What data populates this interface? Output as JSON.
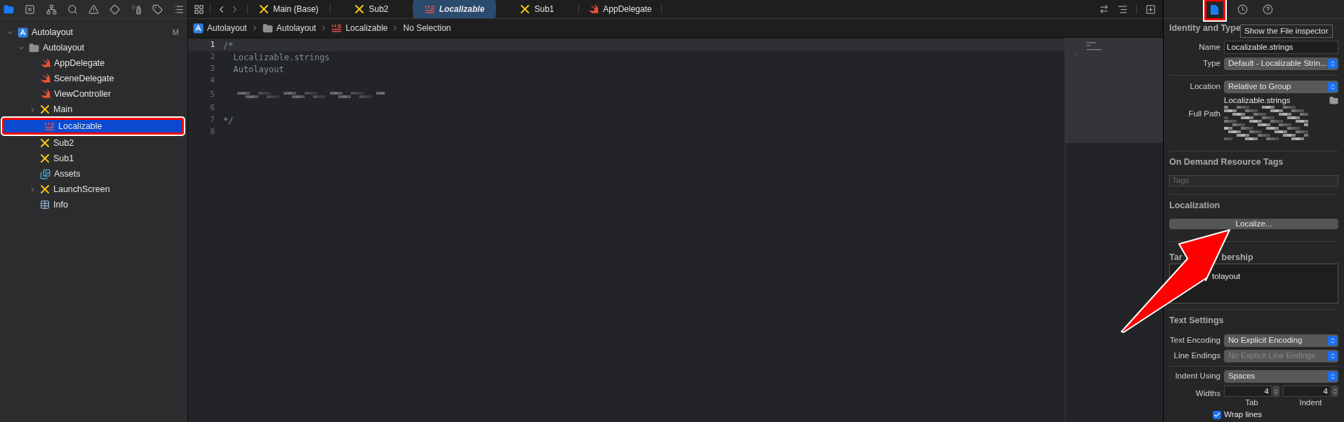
{
  "navigator": {
    "toolbar": [
      {
        "kind": "folder",
        "selected": true
      },
      {
        "kind": "xbox",
        "selected": false
      },
      {
        "kind": "hierarchy",
        "selected": false
      },
      {
        "kind": "search",
        "selected": false
      },
      {
        "kind": "warning",
        "selected": false
      },
      {
        "kind": "diamond",
        "selected": false
      },
      {
        "kind": "spray",
        "selected": false
      },
      {
        "kind": "tag",
        "selected": false
      },
      {
        "kind": "list",
        "selected": false
      }
    ],
    "tree": [
      {
        "name": "Autolayout",
        "kind": "project",
        "badge": "M",
        "expanded": true,
        "selected": false,
        "children": [
          {
            "name": "Autolayout",
            "kind": "folder",
            "expanded": true,
            "selected": false,
            "children": [
              {
                "name": "AppDelegate",
                "kind": "swift",
                "selected": false
              },
              {
                "name": "SceneDelegate",
                "kind": "swift",
                "selected": false
              },
              {
                "name": "ViewController",
                "kind": "swift",
                "selected": false
              },
              {
                "name": "Main",
                "kind": "storyboard",
                "expanded": false,
                "selected": false
              },
              {
                "name": "Localizable",
                "kind": "strings",
                "selected": true
              },
              {
                "name": "Sub2",
                "kind": "storyboard",
                "selected": false
              },
              {
                "name": "Sub1",
                "kind": "storyboard",
                "selected": false
              },
              {
                "name": "Assets",
                "kind": "assets",
                "selected": false
              },
              {
                "name": "LaunchScreen",
                "kind": "storyboard",
                "expanded": false,
                "selected": false
              },
              {
                "name": "Info",
                "kind": "plist",
                "selected": false
              }
            ]
          }
        ]
      }
    ]
  },
  "editor": {
    "tabs": [
      {
        "label": "Main (Base)",
        "kind": "storyboard",
        "selected": false
      },
      {
        "label": "Sub2",
        "kind": "storyboard",
        "selected": false
      },
      {
        "label": "Localizable",
        "kind": "strings",
        "selected": true
      },
      {
        "label": "Sub1",
        "kind": "storyboard",
        "selected": false
      },
      {
        "label": "AppDelegate",
        "kind": "swift",
        "selected": false
      }
    ],
    "breadcrumb": [
      {
        "label": "Autolayout",
        "kind": "project"
      },
      {
        "label": "Autolayout",
        "kind": "folder"
      },
      {
        "label": "Localizable",
        "kind": "strings"
      },
      {
        "label": "No Selection",
        "kind": "none"
      }
    ],
    "lines": [
      {
        "number": "1",
        "text": "/*",
        "current": true
      },
      {
        "number": "2",
        "text": "  Localizable.strings",
        "current": false
      },
      {
        "number": "3",
        "text": "  Autolayout",
        "current": false
      },
      {
        "number": "4",
        "current": false
      },
      {
        "number": "5",
        "kind": "redacted",
        "current": false
      },
      {
        "number": "6",
        "current": false
      },
      {
        "number": "7",
        "text": "*/",
        "current": false
      },
      {
        "number": "8",
        "current": false
      }
    ]
  },
  "inspector": {
    "tabs": [
      {
        "kind": "file",
        "selected": true
      },
      {
        "kind": "history",
        "selected": false
      },
      {
        "kind": "help",
        "selected": false
      }
    ],
    "tooltip": "Show the File inspector",
    "identity": {
      "heading": "Identity and Type",
      "name": {
        "label": "Name",
        "value": "Localizable.strings"
      },
      "type": {
        "label": "Type",
        "value": "Default - Localizable Strin..."
      },
      "location": {
        "label": "Location",
        "value": "Relative to Group"
      },
      "location_file": "Localizable.strings",
      "full_path_label": "Full Path"
    },
    "on_demand": {
      "heading": "On Demand Resource Tags",
      "placeholder": "Tags"
    },
    "localization": {
      "heading": "Localization",
      "button": "Localize..."
    },
    "target_membership": {
      "heading_fragments": [
        "Tar",
        "bership"
      ],
      "item": "tolayout"
    },
    "text_settings": {
      "heading": "Text Settings",
      "groups": [
        [
          {
            "label": "Text Encoding",
            "value": "No Explicit Encoding",
            "disabled": false
          },
          {
            "label": "Line Endings",
            "value": "No Explicit Line Endings",
            "disabled": true
          }
        ],
        [
          {
            "label": "Indent Using",
            "value": "Spaces",
            "disabled": false
          }
        ]
      ],
      "widths": {
        "label": "Widths",
        "fields": [
          {
            "value": "4",
            "caption": "Tab"
          },
          {
            "value": "4",
            "caption": "Indent"
          }
        ]
      },
      "wrap": {
        "label": "Wrap lines",
        "checked": true
      }
    }
  }
}
